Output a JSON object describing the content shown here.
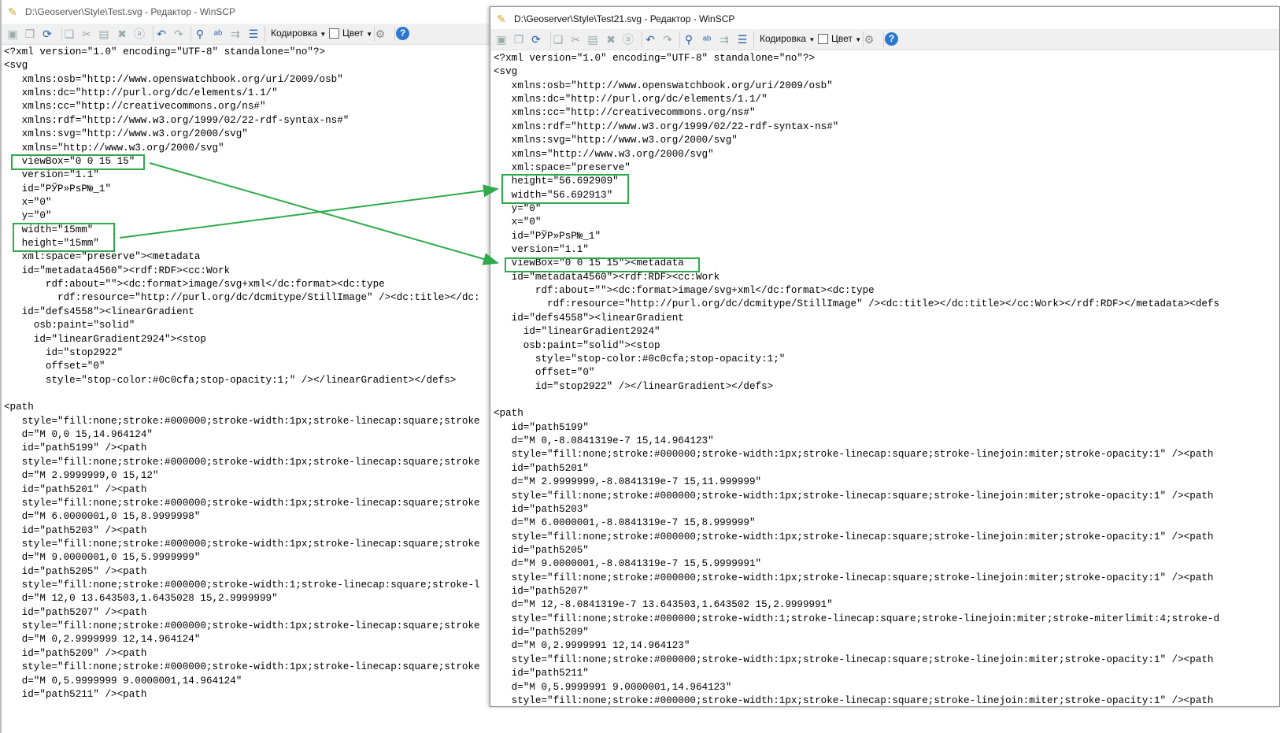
{
  "toolbar": {
    "encoding_label": "Кодировка",
    "color_label": "Цвет",
    "icons": [
      "save-icon",
      "save-all-icon",
      "reload-icon",
      "copy-icon",
      "cut-icon",
      "paste-icon",
      "delete-icon",
      "select-all-icon",
      "undo-icon",
      "redo-icon",
      "find-icon",
      "replace-icon",
      "find-next-icon",
      "goto-line-icon",
      "gear-icon",
      "help-icon"
    ]
  },
  "accent_color": "#2eaa4a",
  "left": {
    "title": "D:\\Geoserver\\Style\\Test.svg - Редактор - WinSCP",
    "lines": [
      "<?xml version=\"1.0\" encoding=\"UTF-8\" standalone=\"no\"?>",
      "<svg",
      "   xmlns:osb=\"http://www.openswatchbook.org/uri/2009/osb\"",
      "   xmlns:dc=\"http://purl.org/dc/elements/1.1/\"",
      "   xmlns:cc=\"http://creativecommons.org/ns#\"",
      "   xmlns:rdf=\"http://www.w3.org/1999/02/22-rdf-syntax-ns#\"",
      "   xmlns:svg=\"http://www.w3.org/2000/svg\"",
      "   xmlns=\"http://www.w3.org/2000/svg\"",
      "   viewBox=\"0 0 15 15\"",
      "   version=\"1.1\"",
      "   id=\"РЎР»РѕР№_1\"",
      "   x=\"0\"",
      "   y=\"0\"",
      "   width=\"15mm\"",
      "   height=\"15mm\"",
      "   xml:space=\"preserve\"><metadata",
      "   id=\"metadata4560\"><rdf:RDF><cc:Work",
      "       rdf:about=\"\"><dc:format>image/svg+xml</dc:format><dc:type",
      "         rdf:resource=\"http://purl.org/dc/dcmitype/StillImage\" /><dc:title></dc:",
      "   id=\"defs4558\"><linearGradient",
      "     osb:paint=\"solid\"",
      "     id=\"linearGradient2924\"><stop",
      "       id=\"stop2922\"",
      "       offset=\"0\"",
      "       style=\"stop-color:#0c0cfa;stop-opacity:1;\" /></linearGradient></defs>",
      "",
      "<path",
      "   style=\"fill:none;stroke:#000000;stroke-width:1px;stroke-linecap:square;stroke",
      "   d=\"M 0,0 15,14.964124\"",
      "   id=\"path5199\" /><path",
      "   style=\"fill:none;stroke:#000000;stroke-width:1px;stroke-linecap:square;stroke",
      "   d=\"M 2.9999999,0 15,12\"",
      "   id=\"path5201\" /><path",
      "   style=\"fill:none;stroke:#000000;stroke-width:1px;stroke-linecap:square;stroke",
      "   d=\"M 6.0000001,0 15,8.9999998\"",
      "   id=\"path5203\" /><path",
      "   style=\"fill:none;stroke:#000000;stroke-width:1px;stroke-linecap:square;stroke",
      "   d=\"M 9.0000001,0 15,5.9999999\"",
      "   id=\"path5205\" /><path",
      "   style=\"fill:none;stroke:#000000;stroke-width:1;stroke-linecap:square;stroke-l",
      "   d=\"M 12,0 13.643503,1.6435028 15,2.9999999\"",
      "   id=\"path5207\" /><path",
      "   style=\"fill:none;stroke:#000000;stroke-width:1px;stroke-linecap:square;stroke",
      "   d=\"M 0,2.9999999 12,14.964124\"",
      "   id=\"path5209\" /><path",
      "   style=\"fill:none;stroke:#000000;stroke-width:1px;stroke-linecap:square;stroke",
      "   d=\"M 0,5.9999999 9.0000001,14.964124\"",
      "   id=\"path5211\" /><path"
    ]
  },
  "right": {
    "title": "D:\\Geoserver\\Style\\Test21.svg - Редактор - WinSCP",
    "lines": [
      "<?xml version=\"1.0\" encoding=\"UTF-8\" standalone=\"no\"?>",
      "<svg",
      "   xmlns:osb=\"http://www.openswatchbook.org/uri/2009/osb\"",
      "   xmlns:dc=\"http://purl.org/dc/elements/1.1/\"",
      "   xmlns:cc=\"http://creativecommons.org/ns#\"",
      "   xmlns:rdf=\"http://www.w3.org/1999/02/22-rdf-syntax-ns#\"",
      "   xmlns:svg=\"http://www.w3.org/2000/svg\"",
      "   xmlns=\"http://www.w3.org/2000/svg\"",
      "   xml:space=\"preserve\"",
      "   height=\"56.692909\"",
      "   width=\"56.692913\"",
      "   y=\"0\"",
      "   x=\"0\"",
      "   id=\"РЎР»РѕР№_1\"",
      "   version=\"1.1\"",
      "   viewBox=\"0 0 15 15\"><metadata",
      "   id=\"metadata4560\"><rdf:RDF><cc:Work",
      "       rdf:about=\"\"><dc:format>image/svg+xml</dc:format><dc:type",
      "         rdf:resource=\"http://purl.org/dc/dcmitype/StillImage\" /><dc:title></dc:title></cc:Work></rdf:RDF></metadata><defs",
      "   id=\"defs4558\"><linearGradient",
      "     id=\"linearGradient2924\"",
      "     osb:paint=\"solid\"><stop",
      "       style=\"stop-color:#0c0cfa;stop-opacity:1;\"",
      "       offset=\"0\"",
      "       id=\"stop2922\" /></linearGradient></defs>",
      "",
      "<path",
      "   id=\"path5199\"",
      "   d=\"M 0,-8.0841319e-7 15,14.964123\"",
      "   style=\"fill:none;stroke:#000000;stroke-width:1px;stroke-linecap:square;stroke-linejoin:miter;stroke-opacity:1\" /><path",
      "   id=\"path5201\"",
      "   d=\"M 2.9999999,-8.0841319e-7 15,11.999999\"",
      "   style=\"fill:none;stroke:#000000;stroke-width:1px;stroke-linecap:square;stroke-linejoin:miter;stroke-opacity:1\" /><path",
      "   id=\"path5203\"",
      "   d=\"M 6.0000001,-8.0841319e-7 15,8.999999\"",
      "   style=\"fill:none;stroke:#000000;stroke-width:1px;stroke-linecap:square;stroke-linejoin:miter;stroke-opacity:1\" /><path",
      "   id=\"path5205\"",
      "   d=\"M 9.0000001,-8.0841319e-7 15,5.9999991\"",
      "   style=\"fill:none;stroke:#000000;stroke-width:1px;stroke-linecap:square;stroke-linejoin:miter;stroke-opacity:1\" /><path",
      "   id=\"path5207\"",
      "   d=\"M 12,-8.0841319e-7 13.643503,1.643502 15,2.9999991\"",
      "   style=\"fill:none;stroke:#000000;stroke-width:1;stroke-linecap:square;stroke-linejoin:miter;stroke-miterlimit:4;stroke-d",
      "   id=\"path5209\"",
      "   d=\"M 0,2.9999991 12,14.964123\"",
      "   style=\"fill:none;stroke:#000000;stroke-width:1px;stroke-linecap:square;stroke-linejoin:miter;stroke-opacity:1\" /><path",
      "   id=\"path5211\"",
      "   d=\"M 0,5.9999991 9.0000001,14.964123\"",
      "   style=\"fill:none;stroke:#000000;stroke-width:1px;stroke-linecap:square;stroke-linejoin:miter;stroke-opacity:1\" /><path"
    ]
  }
}
